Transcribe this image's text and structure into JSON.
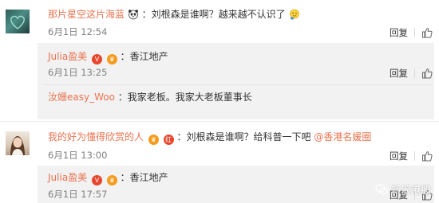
{
  "comments": [
    {
      "user": "那片星空这片海蓝",
      "text": "：刘根森是谁啊？越来越不认识了",
      "time": "6月1日 12:54",
      "reply_label": "回复",
      "replies": [
        {
          "user": "Julia盈美",
          "text": "：香江地产",
          "time": "6月1日 13:25",
          "reply_label": "回复"
        },
        {
          "user": "汝姗easy_Woo",
          "text": "：我家老板。我家大老板董事长"
        }
      ]
    },
    {
      "user": "我的好为懂得欣赏的人",
      "badge": "红",
      "text": "：刘根森是谁啊？给科普一下吧",
      "mention": "@香港名媛圈",
      "time": "6月1日 13:00",
      "reply_label": "回复",
      "replies": [
        {
          "user": "Julia盈美",
          "text": "：香江地产",
          "time": "6月1日 17:57",
          "reply_label": "回复"
        }
      ]
    }
  ],
  "watermark": "新浪港股",
  "colors": {
    "username": "#eb7350",
    "time": "#808080",
    "subblock_bg": "#f2f2f2"
  },
  "icons": {
    "like": "thumbs-up-icon",
    "panda": "panda-emoji-icon",
    "thinking": "thinking-emoji-icon"
  }
}
